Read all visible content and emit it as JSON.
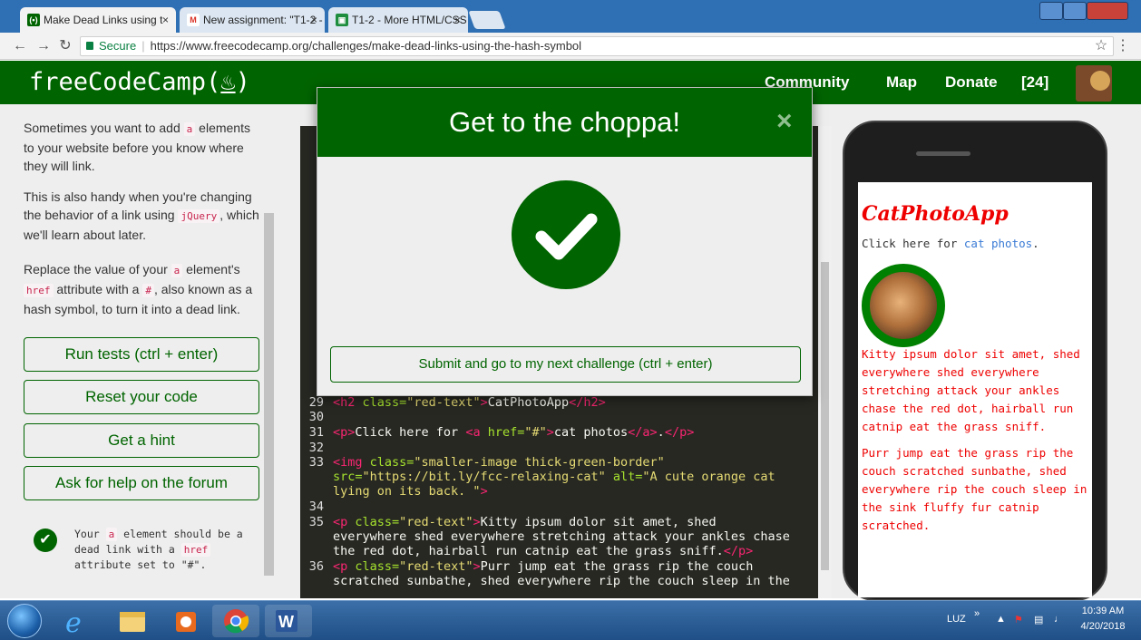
{
  "browser": {
    "tabs": [
      {
        "label": "Make Dead Links using t",
        "icon": "freecodecamp-icon",
        "close": "×"
      },
      {
        "label": "New assignment: \"T1-2 -",
        "icon": "gmail-icon",
        "close": "×"
      },
      {
        "label": "T1-2 - More HTML/CSS E",
        "icon": "classroom-icon",
        "close": "×"
      }
    ],
    "address": {
      "secure_label": "Secure",
      "url": "https://www.freecodecamp.org/challenges/make-dead-links-using-the-hash-symbol"
    }
  },
  "fcc_nav": {
    "logo_text": "freeCodeCamp(",
    "logo_end": ")",
    "links": [
      "Community",
      "Map",
      "Donate",
      "[24]"
    ]
  },
  "instructions": {
    "p1_a": "Sometimes you want to add ",
    "p1_code": "a",
    "p1_b": " elements to your website before you know where they will link.",
    "p2_a": "This is also handy when you're changing the behavior of a link using ",
    "p2_code": "jQuery",
    "p2_b": ", which we'll learn about later.",
    "p3_a": "Replace the value of your ",
    "p3_code1": "a",
    "p3_b": " element's ",
    "p3_code2": "href",
    "p3_c": " attribute with a ",
    "p3_code3": "#",
    "p3_d": ", also known as a hash symbol, to turn it into a dead link."
  },
  "buttons": {
    "run_tests": "Run tests (ctrl + enter)",
    "reset": "Reset your code",
    "hint": "Get a hint",
    "forum": "Ask for help on the forum"
  },
  "test": {
    "a": "Your ",
    "code1": "a",
    "b": " element should be a dead link with a ",
    "code2": "href",
    "c": " attribute set to \"#\"."
  },
  "editor": {
    "l29": {
      "n": "29",
      "t1": "<h2 ",
      "a1": "class=",
      "s1": "\"red-text\"",
      "t2": ">",
      "txt": "CatPhotoApp",
      "t3": "</h2>"
    },
    "l30": {
      "n": "30"
    },
    "l31": {
      "n": "31",
      "t1": "<p>",
      "txt1": "Click here for ",
      "t2": "<a ",
      "a1": "href=",
      "s1": "\"#\"",
      "t3": ">",
      "txt2": "cat photos",
      "t4": "</a>",
      "txt3": ".",
      "t5": "</p>"
    },
    "l32": {
      "n": "32"
    },
    "l33": {
      "n": "33",
      "t1": "<img ",
      "a1": "class=",
      "s1": "\"smaller-image thick-green-border\"",
      "a2": "src=",
      "s2": "\"https://bit.ly/fcc-relaxing-cat\"",
      "a3": " alt=",
      "s3": "\"A cute orange cat",
      "s3b": "lying on its back. \"",
      "t2": ">"
    },
    "l34": {
      "n": "34"
    },
    "l35": {
      "n": "35",
      "t1": "<p ",
      "a1": "class=",
      "s1": "\"red-text\"",
      "t2": ">",
      "txt1": "Kitty ipsum dolor sit amet, shed",
      "txt2": "everywhere shed everywhere stretching attack your ankles chase",
      "txt3": "the red dot, hairball run catnip eat the grass sniff.",
      "t3": "</p>"
    },
    "l36": {
      "n": "36",
      "t1": "<p ",
      "a1": "class=",
      "s1": "\"red-text\"",
      "t2": ">",
      "txt1": "Purr jump eat the grass rip the couch",
      "txt2": "scratched sunbathe, shed everywhere rip the couch sleep in the"
    }
  },
  "preview": {
    "title": "CatPhotoApp",
    "line_a": "Click here for ",
    "line_link": "cat photos",
    "line_b": ".",
    "p1": "Kitty ipsum dolor sit amet, shed everywhere shed everywhere stretching attack your ankles chase the red dot, hairball run catnip eat the grass sniff.",
    "p2": "Purr jump eat the grass rip the couch scratched sunbathe, shed everywhere rip the couch sleep in the sink fluffy fur catnip scratched."
  },
  "modal": {
    "title": "Get to the choppa!",
    "close": "×",
    "submit": "Submit and go to my next challenge (ctrl + enter)"
  },
  "taskbar": {
    "apps": [
      "ie-icon",
      "explorer-icon",
      "media-icon",
      "chrome-icon",
      "word-icon"
    ],
    "tray_lang": "LUZ",
    "tray_expand": "»",
    "time": "10:39 AM",
    "date": "4/20/2018"
  },
  "colors": {
    "fcc_green": "#006400",
    "taskbar": "#1f4f86",
    "editor_bg": "#272822"
  }
}
